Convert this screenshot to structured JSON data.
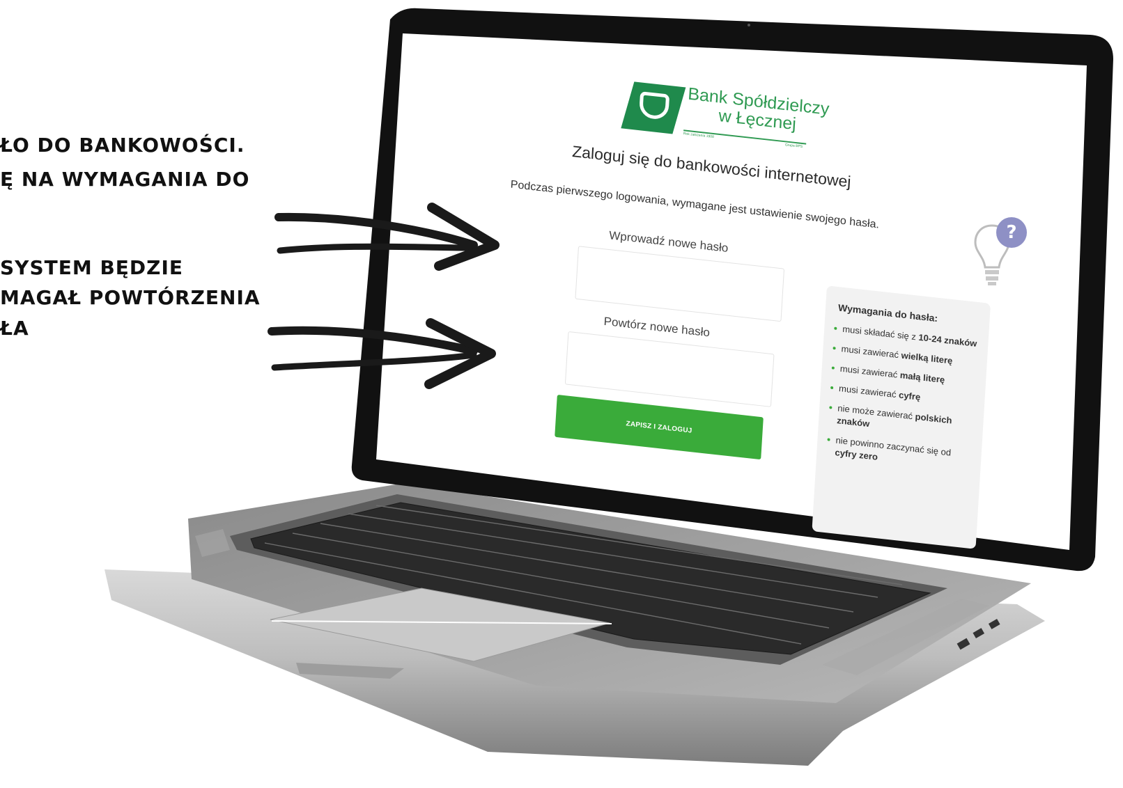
{
  "instructions": {
    "line1": "ŁO DO BANKOWOŚCI.",
    "line2": "Ę NA WYMAGANIA DO",
    "line3": "SYSTEM BĘDZIE",
    "line4": "MAGAŁ  POWTÓRZENIA",
    "line5": "ŁA"
  },
  "bank": {
    "name_line1": "Bank Spółdzielczy",
    "name_line2": "w Łęcznej",
    "tagline_left": "Rok założenia 1908",
    "tagline_right": "Grupa BPS"
  },
  "login": {
    "heading": "Zaloguj się do bankowości internetowej",
    "info": "Podczas pierwszego logowania, wymagane jest ustawienie swojego hasła.",
    "new_password_label": "Wprowadź nowe hasło",
    "repeat_password_label": "Powtórz nowe hasło",
    "new_password_value": "",
    "repeat_password_value": "",
    "submit_label": "ZAPISZ I ZALOGUJ"
  },
  "requirements": {
    "title": "Wymagania do hasła:",
    "items": [
      {
        "pre": "musi składać się z ",
        "bold": "10-24 znaków",
        "post": ""
      },
      {
        "pre": "musi zawierać ",
        "bold": "wielką literę",
        "post": ""
      },
      {
        "pre": "musi zawierać ",
        "bold": "małą literę",
        "post": ""
      },
      {
        "pre": "musi zawierać ",
        "bold": "cyfrę",
        "post": ""
      },
      {
        "pre": "nie może zawierać ",
        "bold": "polskich znaków",
        "post": ""
      },
      {
        "pre": "nie powinno zaczynać się od ",
        "bold": "cyfry zero",
        "post": ""
      }
    ]
  },
  "help_icon_text": "?",
  "colors": {
    "brand_green": "#2f9a52",
    "button_green": "#3aab3a",
    "help_purple": "#8e90c5"
  }
}
